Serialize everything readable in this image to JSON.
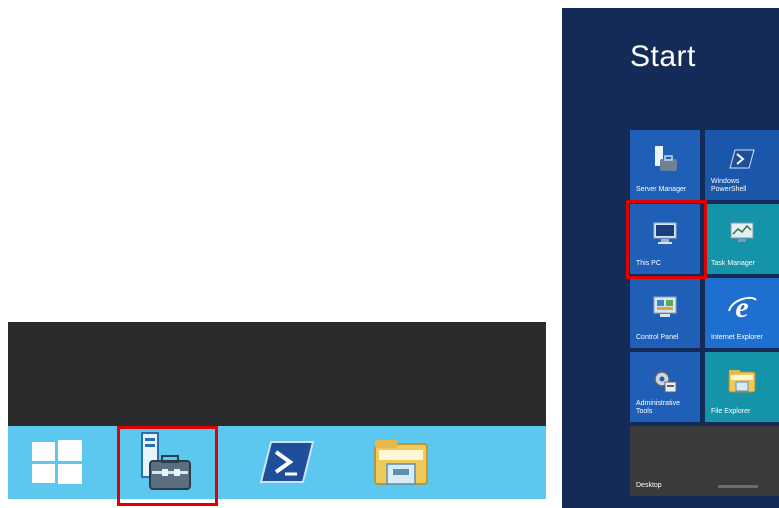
{
  "start_screen": {
    "title": "Start",
    "tiles": [
      {
        "label": "Server Manager"
      },
      {
        "label": "Windows PowerShell"
      },
      {
        "label": "This PC"
      },
      {
        "label": "Task Manager"
      },
      {
        "label": "Control Panel"
      },
      {
        "label": "Internet Explorer"
      },
      {
        "label": "Administrative Tools"
      },
      {
        "label": "File Explorer"
      },
      {
        "label": "Desktop"
      }
    ]
  },
  "taskbar": {
    "icons": [
      "windows-logo-icon",
      "server-manager-icon",
      "powershell-icon",
      "file-explorer-icon"
    ]
  },
  "colors": {
    "taskbar_strip": "#5cc8ef",
    "taskbar_dark": "#2b2b2b",
    "start_background": "#152b57",
    "highlight": "#e00000"
  }
}
